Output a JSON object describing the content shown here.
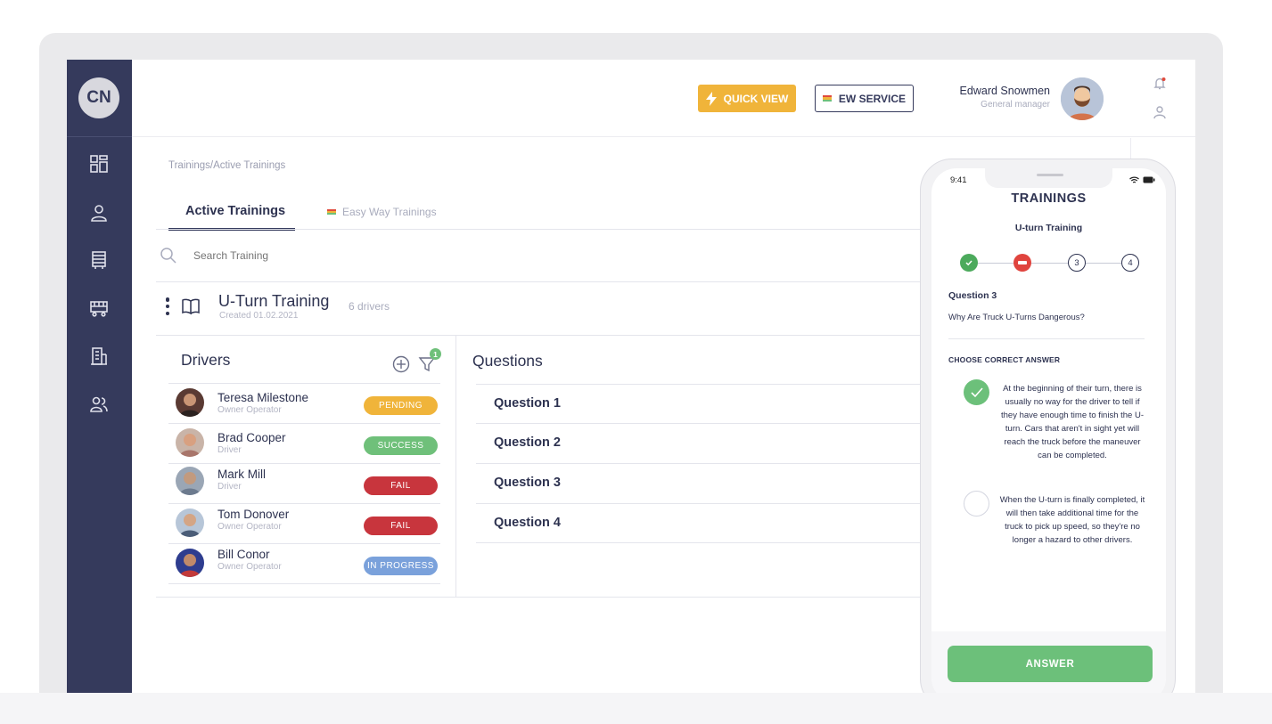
{
  "brand": {
    "logo_text": "CN"
  },
  "sidebar": {
    "items": [
      {
        "icon": "dashboard-icon"
      },
      {
        "icon": "user-icon"
      },
      {
        "icon": "trailer-icon"
      },
      {
        "icon": "truck-icon"
      },
      {
        "icon": "building-icon"
      },
      {
        "icon": "users-icon"
      }
    ]
  },
  "header": {
    "quick_view_label": "QUICK VIEW",
    "ew_service_label": "EW SERVICE",
    "user_name": "Edward Snowmen",
    "user_role": "General manager"
  },
  "breadcrumb": "Trainings/Active Trainings",
  "tabs": [
    {
      "label": "Active Trainings",
      "active": true
    },
    {
      "label": "Easy Way Trainings",
      "active": false
    }
  ],
  "search": {
    "placeholder": "Search Training"
  },
  "training": {
    "title": "U-Turn  Training",
    "created": "Created 01.02.2021",
    "drivers_count": "6 drivers"
  },
  "drivers": {
    "title": "Drivers",
    "filter_badge": "1",
    "rows": [
      {
        "name": "Teresa Milestone",
        "role": "Owner Operator",
        "status": "PENDING",
        "status_color": "#f0b43a",
        "avatar_color": "#5a3a33"
      },
      {
        "name": "Brad Cooper",
        "role": "Driver",
        "status": "SUCCESS",
        "status_color": "#6fc07a",
        "avatar_color": "#a8756a"
      },
      {
        "name": "Mark Mill",
        "role": "Driver",
        "status": "FAIL",
        "status_color": "#c8353d",
        "avatar_color": "#6c7a8e"
      },
      {
        "name": "Tom Donover",
        "role": "Owner Operator",
        "status": "FAIL",
        "status_color": "#c8353d",
        "avatar_color": "#7b8ea6"
      },
      {
        "name": "Bill Conor",
        "role": "Owner Operator",
        "status": "IN PROGRESS",
        "status_color": "#7aa1db",
        "avatar_color": "#2e3d8f"
      }
    ]
  },
  "questions": {
    "title": "Questions",
    "items": [
      "Question 1",
      "Question 2",
      "Question 3",
      "Question 4"
    ]
  },
  "phone": {
    "time": "9:41",
    "title": "TRAININGS",
    "subtitle": "U-turn Training",
    "steps": [
      {
        "state": "done",
        "label": ""
      },
      {
        "state": "failed",
        "label": ""
      },
      {
        "state": "todo",
        "label": "3"
      },
      {
        "state": "todo",
        "label": "4"
      }
    ],
    "question_label": "Question 3",
    "question_text": "Why Are Truck U-Turns Dangerous?",
    "choose_label": "CHOOSE CORRECT ANSWER",
    "answers": [
      {
        "text": "At the beginning of their turn, there is usually no way for the driver to tell if they have enough time to finish the U-turn. Cars that aren't in sight yet will reach the truck before the maneuver can be completed.",
        "selected": true
      },
      {
        "text": "When the U-turn is finally completed, it will then take additional time for the truck to pick up speed, so they're no longer a hazard to other drivers.",
        "selected": false
      }
    ],
    "answer_button": "ANSWER"
  },
  "colors": {
    "sidebar": "#353a5c",
    "accent_yellow": "#f0b43a",
    "success_green": "#6fc07a",
    "fail_red": "#c8353d",
    "progress_blue": "#7aa1db"
  }
}
